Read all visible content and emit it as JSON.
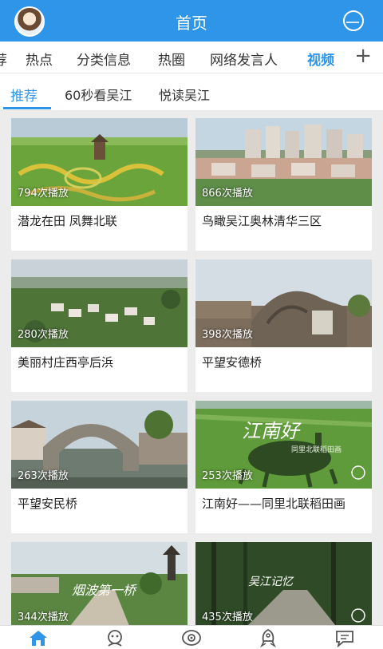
{
  "header": {
    "title": "首页"
  },
  "categories": {
    "items": [
      "荐",
      "热点",
      "分类信息",
      "热圈",
      "网络发言人",
      "视频"
    ],
    "active": "视频",
    "plus": "+"
  },
  "subtabs": [
    "推荐",
    "60秒看吴江",
    "悦读吴江"
  ],
  "videos": [
    {
      "plays": "794次播放",
      "title": "潜龙在田 凤舞北联"
    },
    {
      "plays": "866次播放",
      "title": "鸟瞰吴江奥林清华三区"
    },
    {
      "plays": "280次播放",
      "title": "美丽村庄西亭后浜"
    },
    {
      "plays": "398次播放",
      "title": "平望安德桥"
    },
    {
      "plays": "263次播放",
      "title": "平望安民桥"
    },
    {
      "plays": "253次播放",
      "title": "江南好——同里北联稻田画"
    },
    {
      "plays": "344次播放",
      "title": ""
    },
    {
      "plays": "435次播放",
      "title": ""
    }
  ],
  "overlays": {
    "v6_main": "江南好",
    "v6_sub": "同里北联稻田画",
    "v7_main": "烟波第一桥",
    "v8_main": "吴江记忆"
  },
  "icons": {
    "avatar": "avatar",
    "search": "search-icon",
    "bottom_nav": [
      "home-icon",
      "service-icon",
      "watch-icon",
      "discover-icon",
      "message-icon"
    ]
  },
  "colors": {
    "accent": "#2f95e8"
  }
}
